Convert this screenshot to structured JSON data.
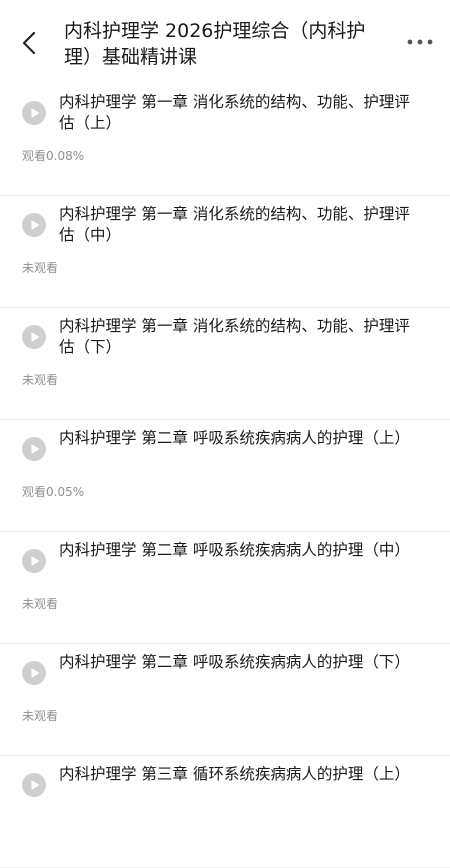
{
  "header": {
    "title": "内科护理学 2026护理综合（内科护理）基础精讲课",
    "back_icon": "chevron-left-icon",
    "more_icon": "more-horizontal-icon"
  },
  "colors": {
    "play_icon_bg": "#cfcfcf",
    "text_primary": "#1a1a1a",
    "text_secondary": "#8f8f8f",
    "divider": "#f0f0f0"
  },
  "lessons": [
    {
      "title": "内科护理学 第一章 消化系统的结构、功能、护理评估（上）",
      "status": "观看0.08%"
    },
    {
      "title": "内科护理学 第一章 消化系统的结构、功能、护理评估（中）",
      "status": "未观看"
    },
    {
      "title": "内科护理学 第一章 消化系统的结构、功能、护理评估（下）",
      "status": "未观看"
    },
    {
      "title": "内科护理学 第二章 呼吸系统疾病病人的护理（上）",
      "status": "观看0.05%"
    },
    {
      "title": "内科护理学 第二章 呼吸系统疾病病人的护理（中）",
      "status": "未观看"
    },
    {
      "title": "内科护理学 第二章 呼吸系统疾病病人的护理（下）",
      "status": "未观看"
    },
    {
      "title": "内科护理学 第三章 循环系统疾病病人的护理（上）",
      "status": ""
    }
  ]
}
